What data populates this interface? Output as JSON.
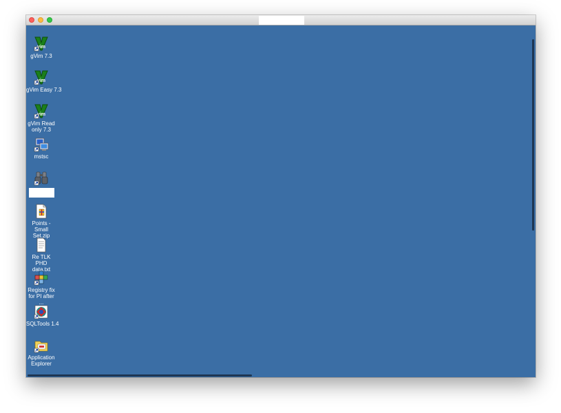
{
  "window": {
    "title": ""
  },
  "desktop": {
    "background_color": "#3b6ea5",
    "icons": [
      {
        "label": "gVim 7.3",
        "icon": "vim-icon"
      },
      {
        "label": "gVim Easy 7.3",
        "icon": "vim-icon"
      },
      {
        "label": "gVim Read only 7.3",
        "icon": "vim-icon"
      },
      {
        "label": "mstsc",
        "icon": "remote-desktop-icon"
      },
      {
        "label": "",
        "icon": "binoculars-icon"
      },
      {
        "label": "Points - Small Set.zip",
        "icon": "zip-file-icon"
      },
      {
        "label": "Re TLK PHD data.txt",
        "icon": "text-file-icon"
      },
      {
        "label": "Registry fix for PI after ...",
        "icon": "registry-icon"
      },
      {
        "label": "SQLTools 1.4",
        "icon": "sqltools-icon"
      },
      {
        "label": "Application Explorer",
        "icon": "folder-icon"
      }
    ]
  }
}
